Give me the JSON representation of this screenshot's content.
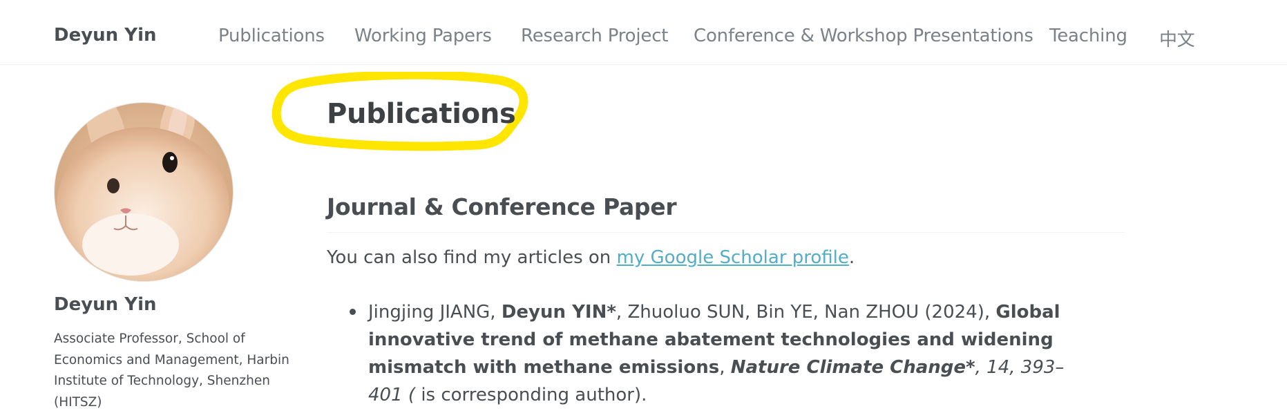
{
  "header": {
    "site_title": "Deyun Yin",
    "nav": [
      {
        "label": "Publications"
      },
      {
        "label": "Working Papers"
      },
      {
        "label": "Research Project"
      },
      {
        "label": "Conference & Workshop Presentations"
      },
      {
        "label": "Teaching"
      },
      {
        "label": "中文"
      }
    ]
  },
  "sidebar": {
    "avatar_alt": "rabbit photo",
    "name": "Deyun Yin",
    "bio": "Associate Professor, School of Economics and Management, Harbin Institute of Technology, Shenzhen (HITSZ)"
  },
  "main": {
    "title": "Publications",
    "section_heading": "Journal & Conference Paper",
    "intro_prefix": "You can also find my articles on ",
    "intro_link": "my Google Scholar profile",
    "intro_suffix": ".",
    "publications": [
      {
        "authors_before": "Jingjing JIANG, ",
        "self_author": "Deyun YIN*",
        "authors_after": ", Zhuoluo SUN, Bin YE, Nan ZHOU (2024), ",
        "title": "Global innovative trend of methane abatement technologies and widening mismatch with methane emissions",
        "sep": ", ",
        "journal": "Nature Climate Change*",
        "pages": ", 14, 393–401 ( ",
        "note": "is corresponding author)."
      }
    ]
  },
  "colors": {
    "highlight": "#ffe600",
    "link": "#52adc8",
    "text": "#494e52",
    "nav": "#7a8288"
  }
}
